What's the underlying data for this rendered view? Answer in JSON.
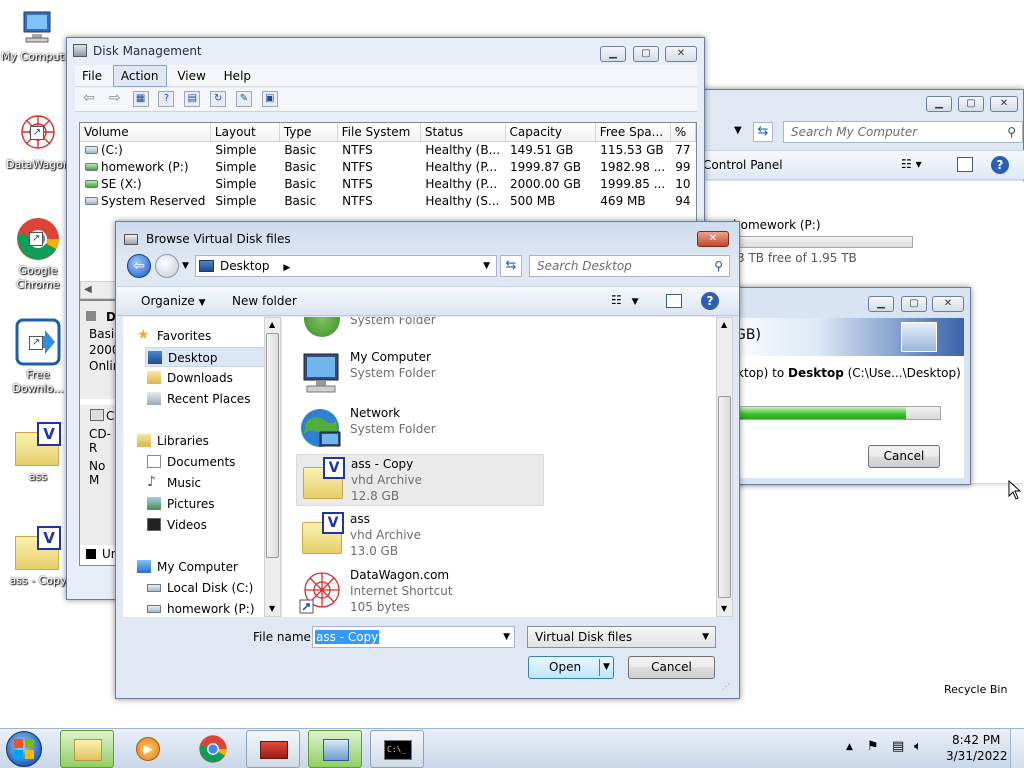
{
  "desktop": {
    "icons": [
      "My Computer",
      "DataWagon",
      "Google Chrome",
      "Free Downlo...",
      "ass",
      "ass - Copy"
    ],
    "recycle_bin": "Recycle Bin"
  },
  "disk_management": {
    "title": "Disk Management",
    "menu": [
      "File",
      "Action",
      "View",
      "Help"
    ],
    "columns": [
      "Volume",
      "Layout",
      "Type",
      "File System",
      "Status",
      "Capacity",
      "Free Spa...",
      "%"
    ],
    "rows": [
      [
        "(C:)",
        "Simple",
        "Basic",
        "NTFS",
        "Healthy (B...",
        "149.51 GB",
        "115.53 GB",
        "77"
      ],
      [
        "homework (P:)",
        "Simple",
        "Basic",
        "NTFS",
        "Healthy (P...",
        "1999.87 GB",
        "1982.98 ...",
        "99"
      ],
      [
        "SE (X:)",
        "Simple",
        "Basic",
        "NTFS",
        "Healthy (P...",
        "2000.00 GB",
        "1999.85 ...",
        "10"
      ],
      [
        "System Reserved",
        "Simple",
        "Basic",
        "NTFS",
        "Healthy (S...",
        "500 MB",
        "469 MB",
        "94"
      ]
    ],
    "lower": {
      "disk_label": "D",
      "disk_lines": [
        "Basic",
        "2000.",
        "Onlin"
      ],
      "cd_label": "CD",
      "cd_line": "CD-R",
      "no_media": "No M",
      "legend": "Un"
    }
  },
  "explorer": {
    "search_placeholder": "Search My Computer",
    "control_panel": "Control Panel",
    "drive_name": "homework (P:)",
    "drive_free": "3 TB free of 1.95 TB"
  },
  "copy_dialog": {
    "heading": "GB)",
    "line_prefix": "ktop)  to ",
    "line_bold": "Desktop",
    "line_suffix": " (C:\\Use...\\Desktop)",
    "progress": 0.83,
    "cancel": "Cancel"
  },
  "browse_dialog": {
    "title": "Browse Virtual Disk files",
    "location": "Desktop",
    "search_placeholder": "Search Desktop",
    "toolbar": {
      "organize": "Organize",
      "new_folder": "New folder"
    },
    "nav": {
      "favorites": "Favorites",
      "fav_items": [
        "Desktop",
        "Downloads",
        "Recent Places"
      ],
      "libraries": "Libraries",
      "lib_items": [
        "Documents",
        "Music",
        "Pictures",
        "Videos"
      ],
      "computer": "My Computer",
      "comp_items": [
        "Local Disk (C:)",
        "homework (P:)"
      ]
    },
    "files": [
      {
        "name": "",
        "type": "System Folder",
        "size": ""
      },
      {
        "name": "My Computer",
        "type": "System Folder",
        "size": ""
      },
      {
        "name": "Network",
        "type": "System Folder",
        "size": ""
      },
      {
        "name": "ass - Copy",
        "type": "vhd Archive",
        "size": "12.8 GB"
      },
      {
        "name": "ass",
        "type": "vhd Archive",
        "size": "13.0 GB"
      },
      {
        "name": "DataWagon.com",
        "type": "Internet Shortcut",
        "size": "105 bytes"
      }
    ],
    "file_name_label": "File name:",
    "file_name_value": "ass - Copy",
    "filter": "Virtual Disk files",
    "open": "Open",
    "cancel": "Cancel"
  },
  "taskbar": {
    "time": "8:42 PM",
    "date": "3/31/2022"
  }
}
